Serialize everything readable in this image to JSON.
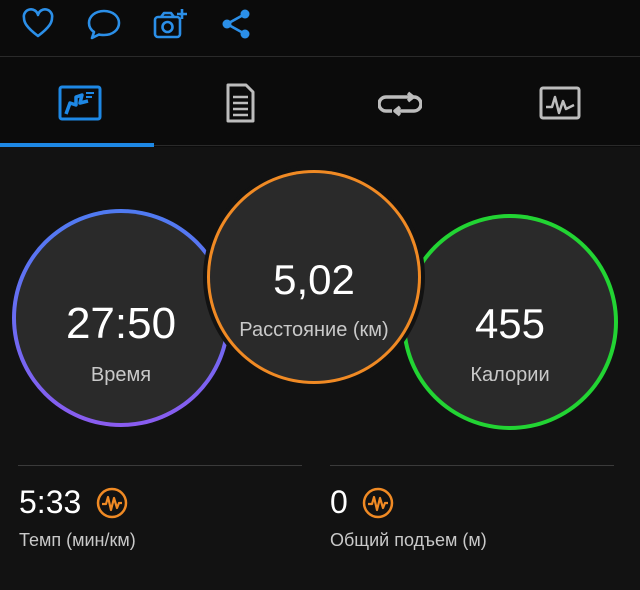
{
  "toolbar": {
    "icons": [
      "heart-icon",
      "comment-icon",
      "camera-add-icon",
      "share-icon"
    ],
    "icon_color": "#2b8fe8"
  },
  "tabs": [
    {
      "name": "summary-tab",
      "icon": "map-chart-icon",
      "active": true
    },
    {
      "name": "details-tab",
      "icon": "document-list-icon",
      "active": false
    },
    {
      "name": "laps-tab",
      "icon": "loop-arrows-icon",
      "active": false
    },
    {
      "name": "charts-tab",
      "icon": "activity-graph-icon",
      "active": false
    }
  ],
  "rings": {
    "time": {
      "value": "27:50",
      "label": "Время",
      "color_start": "#4f7bf2",
      "color_end": "#8a5cf0"
    },
    "distance": {
      "value": "5,02",
      "label": "Расстояние (км)",
      "color": "#f08a24"
    },
    "calories": {
      "value": "455",
      "label": "Калории",
      "color": "#22d433"
    }
  },
  "stats": {
    "pace": {
      "value": "5:33",
      "label": "Темп (мин/км)",
      "icon": "heart-rate-icon"
    },
    "ascent": {
      "value": "0",
      "label": "Общий подъем (м)",
      "icon": "heart-rate-icon"
    }
  },
  "colors": {
    "accent": "#1e88e5",
    "hr_icon": "#f08a24",
    "background": "#121212"
  }
}
